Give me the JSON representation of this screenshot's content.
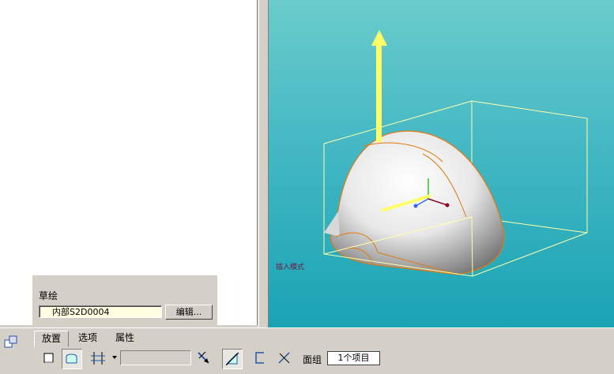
{
  "popup": {
    "title": "草绘",
    "sketch_value": "内部S2D0004",
    "edit_button": "编辑..."
  },
  "viewport": {
    "mode_label": "插入模式"
  },
  "tabs": [
    {
      "label": "放置",
      "active": true
    },
    {
      "label": "选项",
      "active": false
    },
    {
      "label": "属性",
      "active": false
    }
  ],
  "toolbar": {
    "quilt_label": "面组",
    "quilt_value": "1个项目",
    "icons": [
      "placement-icon",
      "solid-icon",
      "surface-icon",
      "depth-option-icon",
      "dropdown-arrow-icon",
      "flip-direction-icon",
      "remove-material-icon",
      "thicken-icon",
      "flip-thicken-icon"
    ]
  },
  "colors": {
    "viewport_top": "#6acccc",
    "viewport_bottom": "#1aa3b4",
    "arrow": "#ffff66",
    "edge": "#e07a10",
    "bbox": "#ffffaa"
  }
}
